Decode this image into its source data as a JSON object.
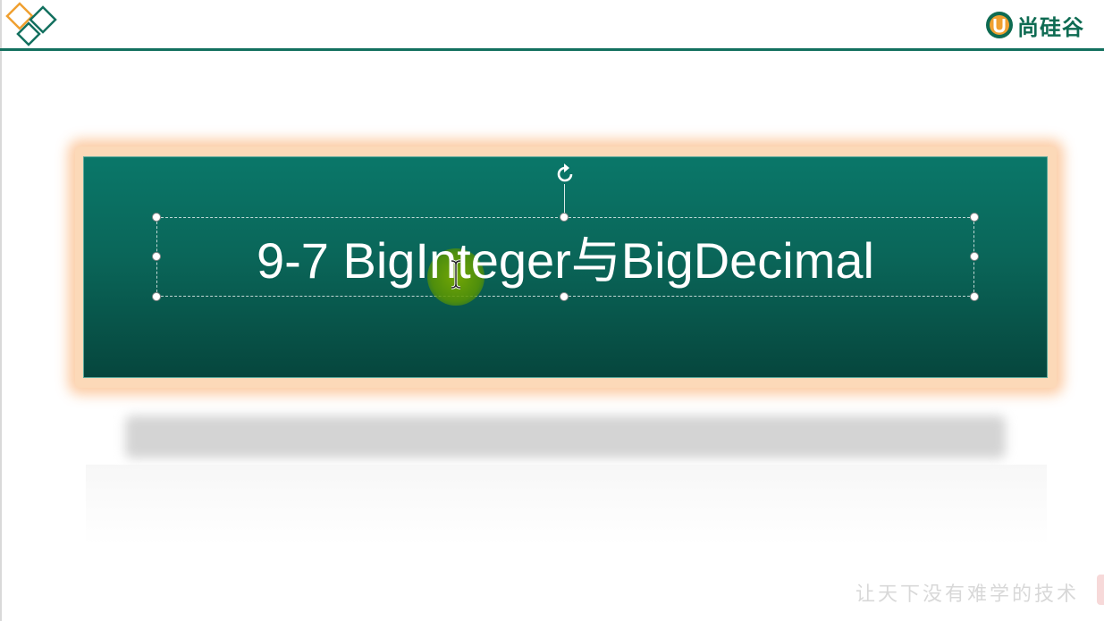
{
  "header": {
    "brand_name": "尚硅谷",
    "brand_badge_letter": "U",
    "logo_icon": "diamond-logo-icon",
    "line_color": "#13705f"
  },
  "slide": {
    "title": "9-7 BigInteger与BigDecimal",
    "slogan": "让天下没有难学的技术",
    "banner_color": "#0a6659",
    "glow_color": "#fcd9b8"
  },
  "editor": {
    "rotate_icon": "rotate-icon",
    "cursor_icon": "ibeam-cursor-icon"
  }
}
